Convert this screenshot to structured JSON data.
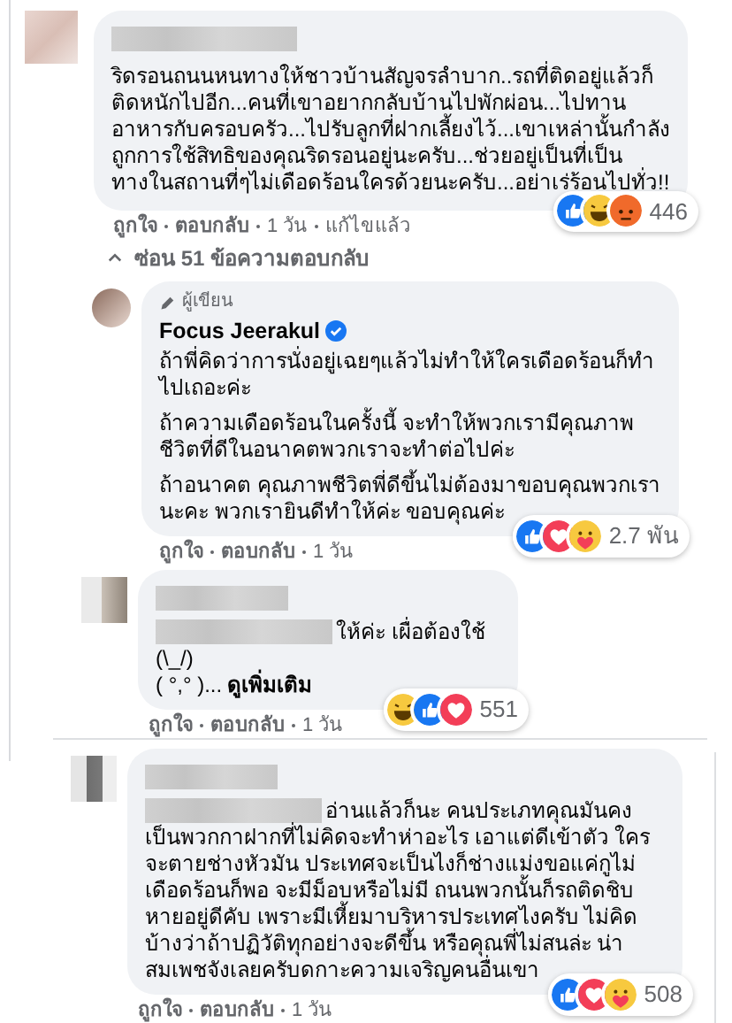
{
  "comment": {
    "text": "ริดรอนถนนหนทางให้ชาวบ้านสัญจรลำบาก..รถที่ติดอยู่แล้วก็ติดหนักไปอีก...คนที่เขาอยากกลับบ้านไปพักผ่อน...ไปทานอาหารกับครอบครัว...ไปรับลูกที่ฝากเลี้ยงไว้...เขาเหล่านั้นกำลังถูกการใช้สิทธิของคุณริดรอนอยู่นะครับ...ช่วยอยู่เป็นที่เป็นทางในสถานที่ๆไม่เดือดร้อนใครด้วยนะครับ...อย่าเร่ร้อนไปทั่ว!!",
    "reactions": [
      {
        "kind": "like"
      },
      {
        "kind": "haha"
      },
      {
        "kind": "angry"
      }
    ],
    "reaction_count": "446",
    "actions": [
      "ถูกใจ",
      "ตอบกลับ",
      "1 วัน",
      "แก้ไขแล้ว"
    ]
  },
  "hide_replies": "ซ่อน 51 ข้อความตอบกลับ",
  "replies": [
    {
      "kind": "author",
      "badge": "ผู้เขียน",
      "name": "Focus Jeerakul",
      "verified": true,
      "paragraphs": [
        "ถ้าพี่คิดว่าการนั่งอยู่เฉยๆแล้วไม่ทำให้ใครเดือดร้อนก็ทำไปเถอะค่ะ",
        "ถ้าความเดือดร้อนในครั้งนี้ จะทำให้พวกเรามีคุณภาพชีวิตที่ดีในอนาคตพวกเราจะทำต่อไปค่ะ",
        "ถ้าอนาคต คุณภาพชีวิตพี่ดีขึ้นไม่ต้องมาขอบคุณพวกเรานะคะ พวกเรายินดีทำให้ค่ะ ขอบคุณค่ะ"
      ],
      "reactions": [
        {
          "kind": "like"
        },
        {
          "kind": "love"
        },
        {
          "kind": "care"
        }
      ],
      "reaction_count": "2.7 พัน",
      "actions": [
        "ถูกใจ",
        "ตอบกลับ",
        "1 วัน"
      ]
    },
    {
      "kind": "user",
      "lines": [
        "ให้ค่ะ เผื่อต้องใช้",
        "(\\_/)",
        "( °,° )..."
      ],
      "see_more": "ดูเพิ่มเติม",
      "reactions": [
        {
          "kind": "haha"
        },
        {
          "kind": "like"
        },
        {
          "kind": "love"
        }
      ],
      "reaction_count": "551",
      "actions": [
        "ถูกใจ",
        "ตอบกลับ",
        "1 วัน"
      ]
    },
    {
      "kind": "user",
      "lines": [
        "อ่านแล้วก็นะ คนประเภทคุณมันคง",
        "เป็นพวกกาฝากที่ไม่คิดจะทำห่าอะไร เอาแต่ดีเข้าตัว ใครจะตายช่างหัวมัน ประเทศจะเป็นไงก็ช่างแม่งขอแค่กูไม่เดือดร้อนก็พอ จะมีม็อบหรือไม่มี ถนนพวกนั้นก็รถติดชิบหายอยู่ดีคับ เพราะมีเหี้ยมาบริหารประเทศไงครับ ไม่คิดบ้างว่าถ้าปฏิวัติทุกอย่างจะดีขึ้น หรือคุณพี่ไม่สนล่ะ น่าสมเพชจังเลยครับดกาะความเจริญคนอื่นเขา"
      ],
      "reactions": [
        {
          "kind": "like"
        },
        {
          "kind": "love"
        },
        {
          "kind": "care"
        }
      ],
      "reaction_count": "508",
      "actions": [
        "ถูกใจ",
        "ตอบกลับ",
        "1 วัน"
      ]
    }
  ]
}
